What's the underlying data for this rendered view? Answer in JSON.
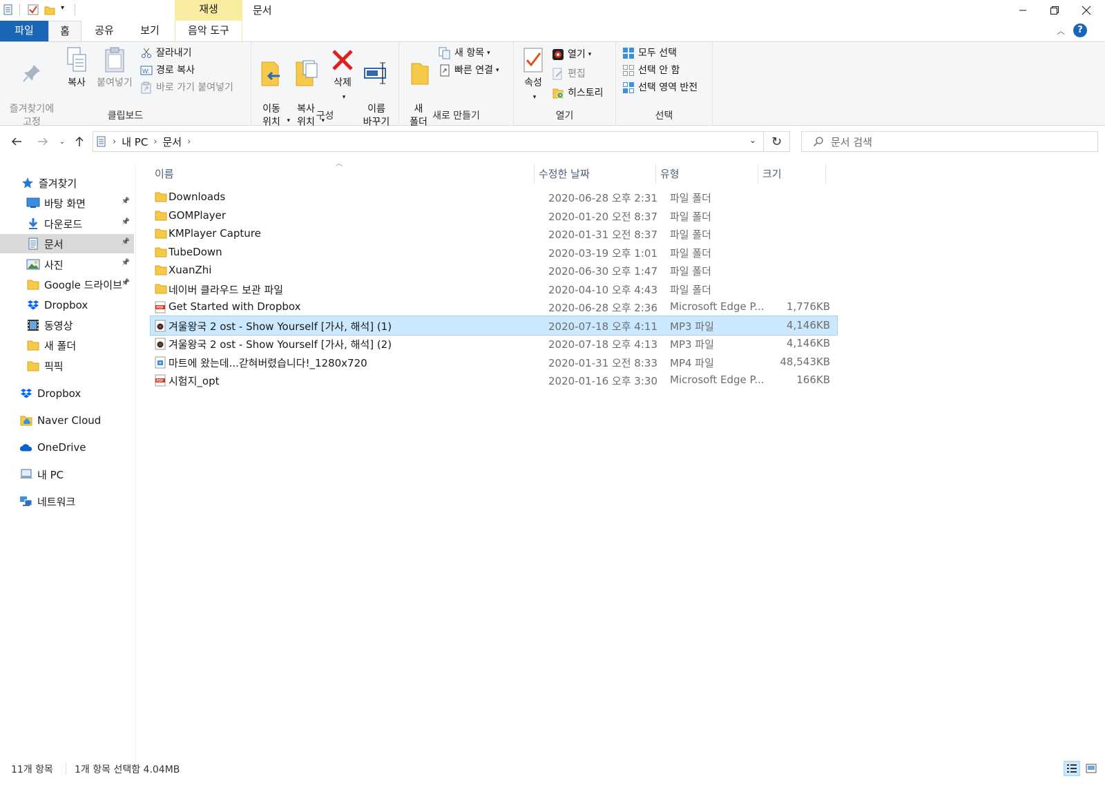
{
  "titlebar": {
    "context_tab": "재생",
    "window_title": "문서",
    "colors": {
      "file_tab": "#1a66b6",
      "context_tab": "#f8eda0",
      "selection": "#cce8ff"
    }
  },
  "tabs": [
    {
      "label": "파일"
    },
    {
      "label": "홈"
    },
    {
      "label": "공유"
    },
    {
      "label": "보기"
    },
    {
      "label": "음악 도구"
    }
  ],
  "ribbon": {
    "clipboard": {
      "label": "클립보드",
      "pin": "즐겨찾기에\n고정",
      "copy": "복사",
      "paste": "붙여넣기",
      "cut": "잘라내기",
      "copy_path": "경로 복사",
      "paste_shortcut": "바로 가기 붙여넣기"
    },
    "organize": {
      "label": "구성",
      "move_to": "이동\n위치",
      "copy_to": "복사\n위치",
      "delete": "삭제",
      "rename": "이름\n바꾸기"
    },
    "new": {
      "label": "새로 만들기",
      "new_folder": "새\n폴더",
      "new_item": "새 항목",
      "easy_access": "빠른 연결"
    },
    "open": {
      "label": "열기",
      "properties": "속성",
      "open": "열기",
      "edit": "편집",
      "history": "히스토리"
    },
    "select": {
      "label": "선택",
      "select_all": "모두 선택",
      "select_none": "선택 안 함",
      "invert": "선택 영역 반전"
    }
  },
  "address": {
    "crumbs": [
      "내 PC",
      "문서"
    ],
    "search_placeholder": "문서 검색"
  },
  "sidebar": {
    "items": [
      {
        "label": "즐겨찾기",
        "icon": "star-icon"
      },
      {
        "label": "바탕 화면",
        "icon": "desktop-icon",
        "pinned": true
      },
      {
        "label": "다운로드",
        "icon": "download-icon",
        "pinned": true
      },
      {
        "label": "문서",
        "icon": "document-icon",
        "pinned": true,
        "selected": true
      },
      {
        "label": "사진",
        "icon": "picture-icon",
        "pinned": true
      },
      {
        "label": "Google 드라이브",
        "icon": "folder-icon",
        "pinned": true
      },
      {
        "label": "Dropbox",
        "icon": "dropbox-icon"
      },
      {
        "label": "동영상",
        "icon": "video-icon"
      },
      {
        "label": "새 폴더",
        "icon": "folder-icon"
      },
      {
        "label": "픽픽",
        "icon": "folder-icon"
      },
      {
        "label": "Dropbox",
        "icon": "dropbox-icon"
      },
      {
        "label": "Naver Cloud",
        "icon": "cloud-folder-icon"
      },
      {
        "label": "OneDrive",
        "icon": "onedrive-icon"
      },
      {
        "label": "내 PC",
        "icon": "pc-icon"
      },
      {
        "label": "네트워크",
        "icon": "network-icon"
      }
    ]
  },
  "filelist": {
    "columns": [
      "이름",
      "수정한 날짜",
      "유형",
      "크기"
    ],
    "rows": [
      {
        "name": "Downloads",
        "date": "2020-06-28 오후 2:31",
        "type": "파일 폴더",
        "size": "",
        "icon": "folder-icon"
      },
      {
        "name": "GOMPlayer",
        "date": "2020-01-20 오전 8:37",
        "type": "파일 폴더",
        "size": "",
        "icon": "folder-icon"
      },
      {
        "name": "KMPlayer Capture",
        "date": "2020-01-31 오전 8:37",
        "type": "파일 폴더",
        "size": "",
        "icon": "folder-icon"
      },
      {
        "name": "TubeDown",
        "date": "2020-03-19 오후 1:01",
        "type": "파일 폴더",
        "size": "",
        "icon": "folder-icon"
      },
      {
        "name": "XuanZhi",
        "date": "2020-06-30 오후 1:47",
        "type": "파일 폴더",
        "size": "",
        "icon": "folder-icon"
      },
      {
        "name": "네이버 클라우드 보관 파일",
        "date": "2020-04-10 오후 4:43",
        "type": "파일 폴더",
        "size": "",
        "icon": "folder-icon"
      },
      {
        "name": "Get Started with Dropbox",
        "date": "2020-06-28 오후 2:36",
        "type": "Microsoft Edge P...",
        "size": "1,776KB",
        "icon": "pdf-icon"
      },
      {
        "name": "겨울왕국 2 ost - Show Yourself [가사, 해석] (1)",
        "date": "2020-07-18 오후 4:11",
        "type": "MP3 파일",
        "size": "4,146KB",
        "icon": "audio-icon",
        "selected": true
      },
      {
        "name": "겨울왕국 2 ost - Show Yourself [가사, 해석] (2)",
        "date": "2020-07-18 오후 4:13",
        "type": "MP3 파일",
        "size": "4,146KB",
        "icon": "audio-icon"
      },
      {
        "name": "마트에 왔는데...갇혀버렸습니다!_1280x720",
        "date": "2020-01-31 오전 8:33",
        "type": "MP4 파일",
        "size": "48,543KB",
        "icon": "video-file-icon"
      },
      {
        "name": "시험지_opt",
        "date": "2020-01-16 오후 3:30",
        "type": "Microsoft Edge P...",
        "size": "166KB",
        "icon": "pdf-icon"
      }
    ]
  },
  "status": {
    "count": "11개 항목",
    "selection": "1개 항목 선택함 4.04MB"
  }
}
